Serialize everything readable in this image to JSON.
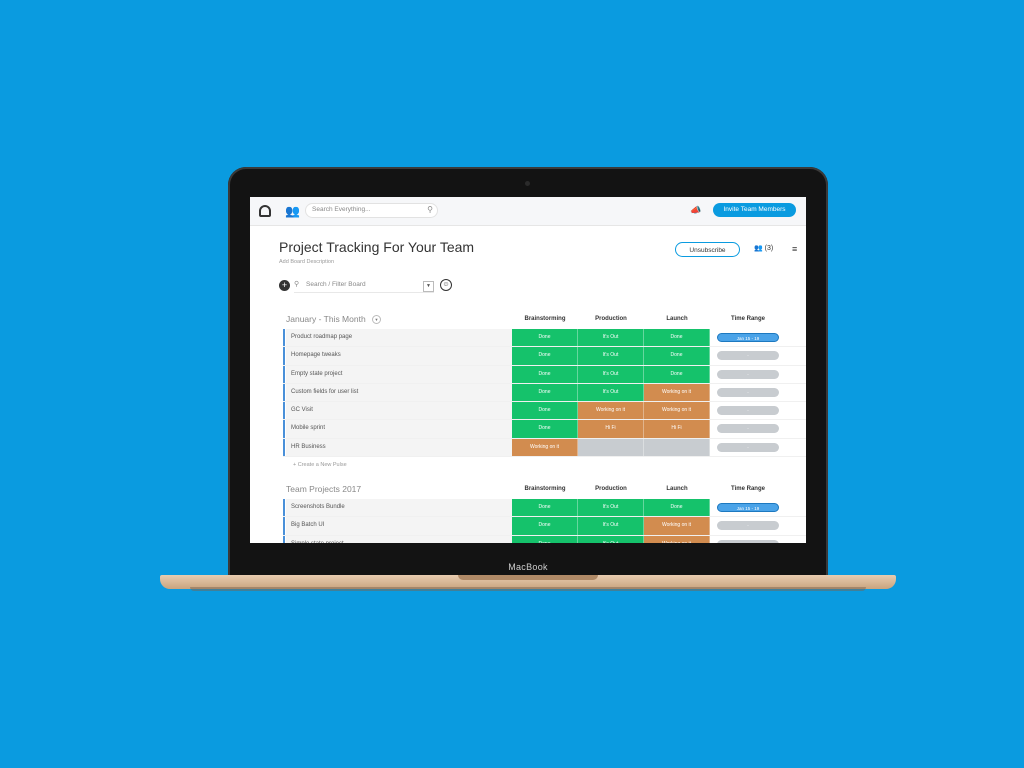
{
  "device": {
    "brand": "MacBook"
  },
  "topbar": {
    "search_placeholder": "Search Everything...",
    "invite_label": "Invite Team Members"
  },
  "board": {
    "title": "Project Tracking For Your Team",
    "description": "Add Board Description",
    "unsubscribe_label": "Unsubscribe",
    "subscribers": "(3)",
    "filter_placeholder": "Search / Filter Board"
  },
  "groups": [
    {
      "title": "January - This Month",
      "columns": [
        "Brainstorming",
        "Production",
        "Launch",
        "Time Range"
      ],
      "new_pulse_label": "+ Create a New Pulse",
      "rows": [
        {
          "name": "Product roadmap page",
          "b": "Done",
          "p": "It's Out",
          "l": "Done",
          "tr": "Jan 15 - 19"
        },
        {
          "name": "Homepage tweaks",
          "b": "Done",
          "p": "It's Out",
          "l": "Done",
          "tr": "-"
        },
        {
          "name": "Empty state project",
          "b": "Done",
          "p": "It's Out",
          "l": "Done",
          "tr": "-"
        },
        {
          "name": "Custom fields for user list",
          "b": "Done",
          "p": "It's Out",
          "l": "Working on it",
          "tr": "-"
        },
        {
          "name": "GC Visit",
          "b": "Done",
          "p": "Working on it",
          "l": "Working on it",
          "tr": "-"
        },
        {
          "name": "Mobile sprint",
          "b": "Done",
          "p": "Hi Fi",
          "l": "Hi Fi",
          "tr": "-"
        },
        {
          "name": "HR Business",
          "b": "Working on it",
          "p": "",
          "l": "",
          "tr": "-"
        }
      ]
    },
    {
      "title": "Team Projects 2017",
      "columns": [
        "Brainstorming",
        "Production",
        "Launch",
        "Time Range"
      ],
      "rows": [
        {
          "name": "Screenshots Bundle",
          "b": "Done",
          "p": "It's Out",
          "l": "Done",
          "tr": "Jan 15 - 19"
        },
        {
          "name": "Big Batch UI",
          "b": "Done",
          "p": "It's Out",
          "l": "Working on it",
          "tr": "-"
        },
        {
          "name": "Simple state project",
          "b": "Done",
          "p": "It's Out",
          "l": "Working on it",
          "tr": "-"
        }
      ]
    }
  ],
  "status_colors": {
    "Done": "#15c26b",
    "Working on it": "#d28c4f",
    "It's Out": "#15c26b",
    "Hi Fi": "#d28c4f",
    "": "#c8ccd0"
  },
  "icons": [
    "logo-icon",
    "user-icon",
    "search-icon",
    "megaphone-icon",
    "subscribers-icon",
    "menu-icon",
    "add-icon",
    "filter-icon",
    "dropdown-icon",
    "person-icon",
    "plus-icon"
  ]
}
